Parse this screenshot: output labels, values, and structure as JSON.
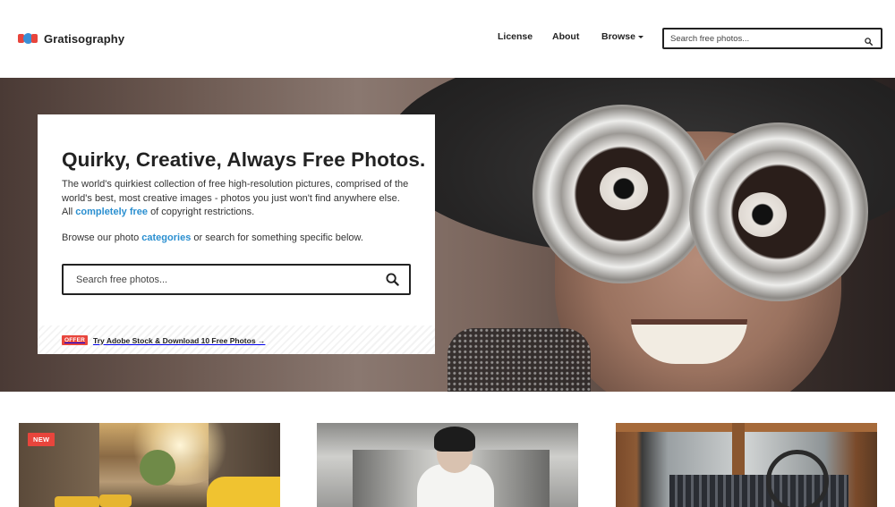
{
  "header": {
    "brand": "Gratisography",
    "nav": {
      "license": "License",
      "about": "About",
      "browse": "Browse"
    },
    "search": {
      "placeholder": "Search free photos..."
    }
  },
  "hero": {
    "title": "Quirky, Creative, Always Free Photos.",
    "intro_text_1": "The world's quirkiest collection of free high-resolution pictures, comprised of the world's best, most creative images - photos you just won't find anywhere else. All",
    "intro_link": "completely free",
    "intro_text_2": "of copyright restrictions.",
    "browse_text_1": "Browse our photo",
    "browse_link": "categories",
    "browse_text_2": "or search for something specific below.",
    "search": {
      "placeholder": "Search free photos..."
    },
    "offer": {
      "tag": "OFFER",
      "text": "Try Adobe Stock & Download 10 Free Photos →"
    }
  },
  "gallery": {
    "items": [
      {
        "badge": "NEW",
        "icon": "taxi-street-photo"
      },
      {
        "icon": "escalator-man-photo"
      },
      {
        "icon": "vintage-car-interior-photo"
      }
    ]
  },
  "colors": {
    "accent_link": "#2a8fd0",
    "badge_red": "#e8453c",
    "text": "#222222"
  }
}
